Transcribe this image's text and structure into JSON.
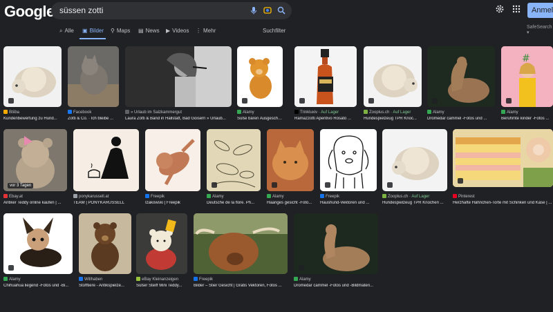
{
  "header": {
    "logo": "Google",
    "query": "süssen zotti",
    "signin_label": "Anmelde",
    "safesearch": "SafeSearch ▾"
  },
  "tabs": [
    {
      "label": "Alle",
      "icon": "⌕"
    },
    {
      "label": "Bilder",
      "icon": "▣"
    },
    {
      "label": "Maps",
      "icon": "⚲"
    },
    {
      "label": "News",
      "icon": "▤"
    },
    {
      "label": "Videos",
      "icon": "▶"
    },
    {
      "label": "Mehr",
      "icon": "⋮"
    }
  ],
  "tools_label": "Suchfilter",
  "results": [
    {
      "source": "Btiiba",
      "title": "Kundenbewertung zu Hund...",
      "stock": "",
      "favicon": "#f9ab00"
    },
    {
      "source": "Facebook",
      "title": "Zotti & Co. · Ich bleibe ...",
      "stock": "",
      "favicon": "#1877f2"
    },
    {
      "source": "» Urlaub im Salzkammergut",
      "title": "Laura Zotti & Band in Hallstatt, Bad Goisern » Urlaub...",
      "stock": "",
      "favicon": "#5f6368"
    },
    {
      "source": "Alamy",
      "title": "Süße bären Ausgeschn...",
      "stock": "",
      "favicon": "#34a853"
    },
    {
      "source": "Trinkluxiv ·",
      "title": "Ramazzotti Aperitivo Rosato ...",
      "stock": "Auf Lager",
      "favicon": "#000000"
    },
    {
      "source": "Zooplus.ch ·",
      "title": "Hundespielzeug TPR Knoc...",
      "stock": "Auf Lager",
      "favicon": "#7cb342"
    },
    {
      "source": "Alamy",
      "title": "Dromedar cammel -Fotos und ...",
      "stock": "",
      "favicon": "#34a853"
    },
    {
      "source": "Alamy",
      "title": "Berühmte kinder -Fotos ...",
      "stock": "",
      "favicon": "#34a853"
    },
    {
      "source": "Ebay.at",
      "title": "Antiker Teddy online kaufen | ...",
      "stock": "",
      "favicon": "#e53238",
      "time_badge": "vor 3 Tagen"
    },
    {
      "source": "ponykarussell.at",
      "title": "TEAM | PONYKARUSSELL",
      "stock": "",
      "favicon": "#9aa0a6"
    },
    {
      "source": "Freepik",
      "title": "Izakowski | Freepik",
      "stock": "",
      "favicon": "#1273eb"
    },
    {
      "source": "Alamy",
      "title": "Deutsche de la flore. Ph...",
      "stock": "",
      "favicon": "#34a853"
    },
    {
      "source": "Alamy",
      "title": "Haariges gesicht -Foto...",
      "stock": "",
      "favicon": "#34a853"
    },
    {
      "source": "Freepik",
      "title": "Haushund-Vektoren und ...",
      "stock": "",
      "favicon": "#1273eb"
    },
    {
      "source": "Zooplus.ch ·",
      "title": "Hundespielzeug TPR Knochen ...",
      "stock": "Auf Lager",
      "favicon": "#7cb342"
    },
    {
      "source": "Pinterest",
      "title": "Herzhafte Hähnchen-Torte mit Schinken und Käse | ...",
      "stock": "",
      "favicon": "#e60023"
    },
    {
      "source": "Alamy",
      "title": "Chihuahua liegend -Fotos und -Bi...",
      "stock": "",
      "favicon": "#34a853"
    },
    {
      "source": "Willhaben",
      "title": "Stofftiere - Antikspielze...",
      "stock": "",
      "favicon": "#1a73e8"
    },
    {
      "source": "eBay Kleinanzeigen",
      "title": "Süßer Steiff Mini Teddy...",
      "stock": "",
      "favicon": "#9ac33c"
    },
    {
      "source": "Freepik",
      "title": "Bilder – Stier Gesicht | Gratis Vektoren, Fotos ...",
      "stock": "",
      "favicon": "#1273eb"
    },
    {
      "source": "Alamy",
      "title": "Dromedar cammel -Fotos und -Bildmateri...",
      "stock": "",
      "favicon": "#34a853"
    }
  ]
}
